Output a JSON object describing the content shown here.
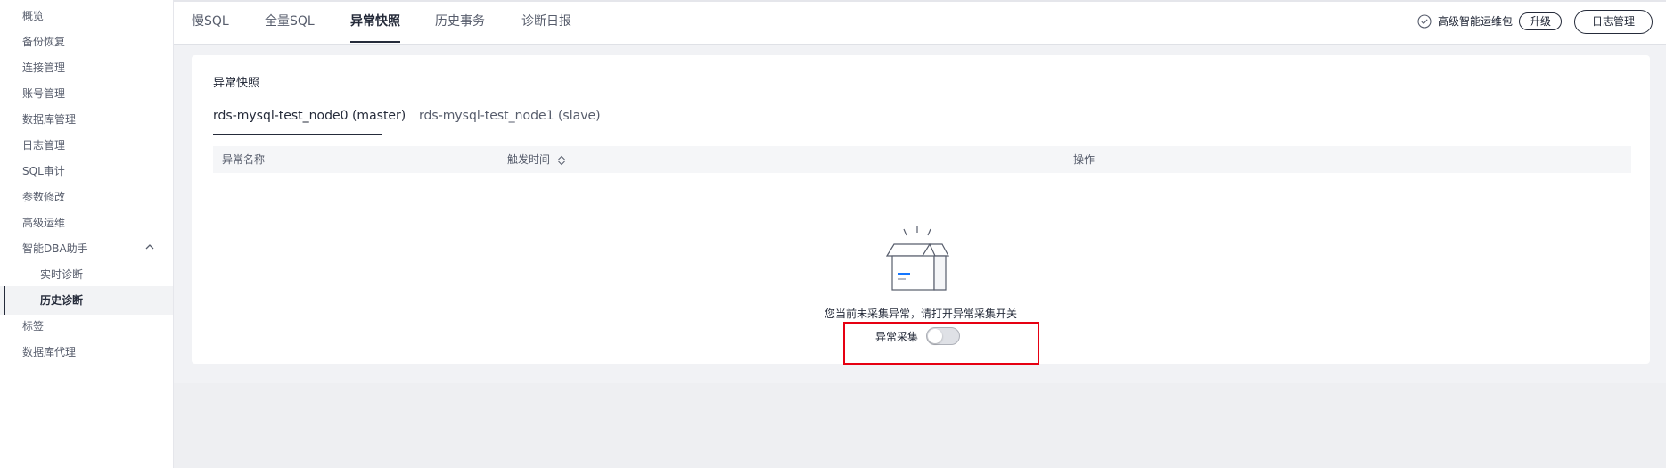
{
  "sidebar": {
    "items": [
      {
        "label": "概览"
      },
      {
        "label": "备份恢复"
      },
      {
        "label": "连接管理"
      },
      {
        "label": "账号管理"
      },
      {
        "label": "数据库管理"
      },
      {
        "label": "日志管理"
      },
      {
        "label": "SQL审计"
      },
      {
        "label": "参数修改"
      },
      {
        "label": "高级运维"
      },
      {
        "label": "智能DBA助手",
        "expanded": true
      },
      {
        "label": "实时诊断",
        "sub": true
      },
      {
        "label": "历史诊断",
        "sub": true,
        "active": true
      },
      {
        "label": "标签"
      },
      {
        "label": "数据库代理"
      }
    ]
  },
  "header": {
    "tabs": [
      {
        "label": "慢SQL"
      },
      {
        "label": "全量SQL"
      },
      {
        "label": "异常快照",
        "active": true
      },
      {
        "label": "历史事务"
      },
      {
        "label": "诊断日报"
      }
    ],
    "package_label": "高级智能运维包",
    "package_icon": "check-circle-icon",
    "upgrade_label": "升级",
    "log_button_label": "日志管理"
  },
  "main": {
    "card_title": "异常快照",
    "node_tabs": [
      {
        "label": "rds-mysql-test_node0 (master)",
        "active": true
      },
      {
        "label": "rds-mysql-test_node1 (slave)"
      }
    ],
    "table": {
      "columns": [
        "异常名称",
        "触发时间",
        "操作"
      ]
    },
    "empty": {
      "icon": "empty-box-icon",
      "message": "您当前未采集异常，请打开异常采集开关",
      "switch_label": "异常采集",
      "switch_on": false
    }
  },
  "colors": {
    "accent": "#252b3a",
    "highlight_border": "#e60012",
    "page_bg": "#f1f2f5"
  }
}
